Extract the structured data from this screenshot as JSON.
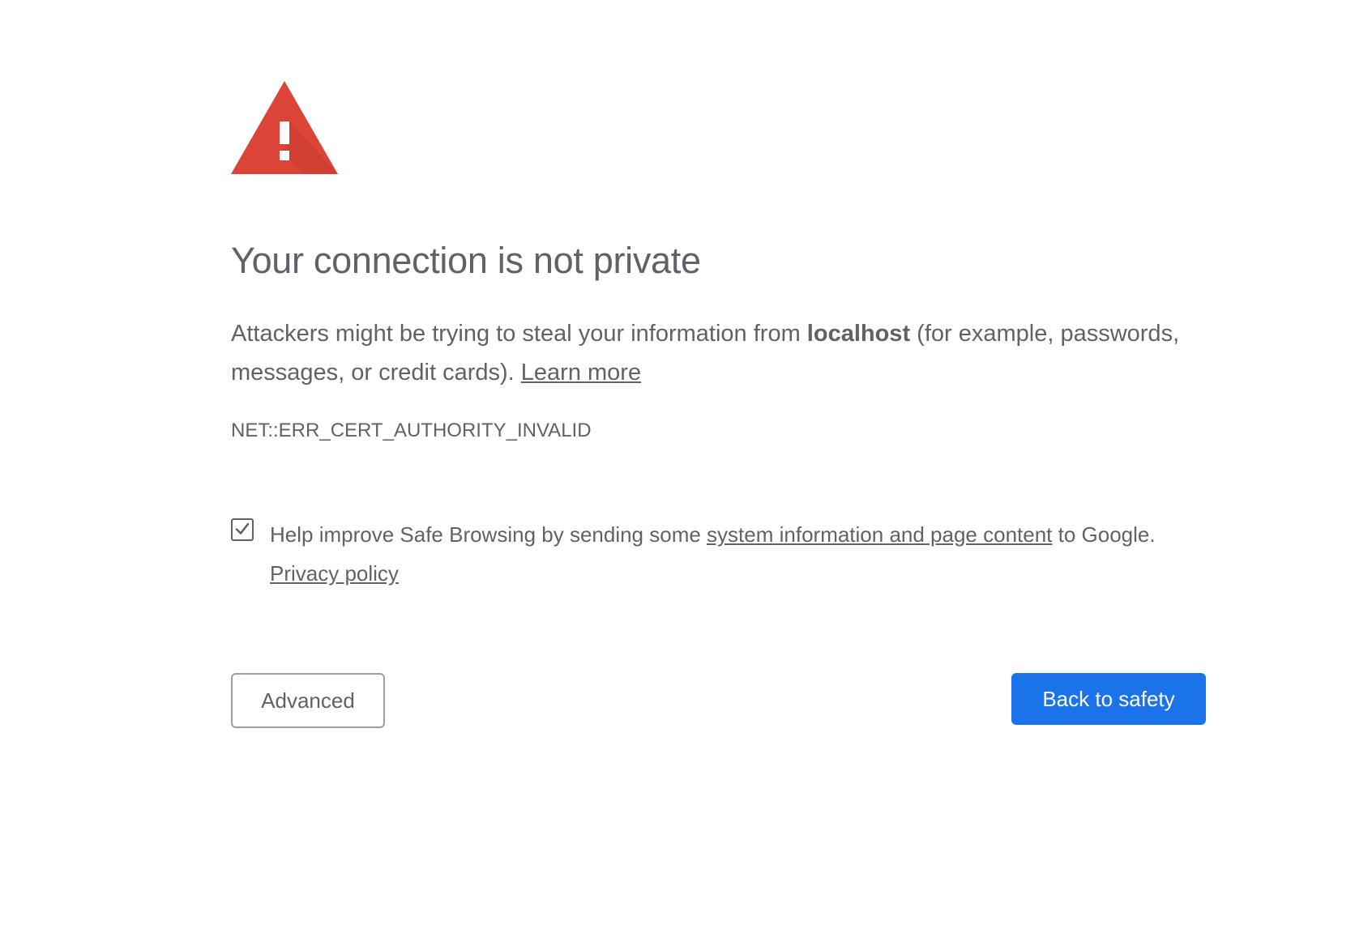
{
  "icon": {
    "name": "warning-triangle-icon",
    "color": "#db4437"
  },
  "title": "Your connection is not private",
  "message": {
    "part1": "Attackers might be trying to steal your information from ",
    "host": "localhost",
    "part2": " (for example, passwords, messages, or credit cards). ",
    "learn_more": "Learn more"
  },
  "error_code": "NET::ERR_CERT_AUTHORITY_INVALID",
  "safe_browsing": {
    "checked": true,
    "text_before": "Help improve Safe Browsing by sending some ",
    "link_text": "system information and page content",
    "text_after": " to Google. ",
    "privacy_link": "Privacy policy"
  },
  "buttons": {
    "advanced": "Advanced",
    "back_to_safety": "Back to safety"
  },
  "colors": {
    "text": "#5f6368",
    "primary_button": "#1a73e8",
    "warning": "#db4437"
  }
}
